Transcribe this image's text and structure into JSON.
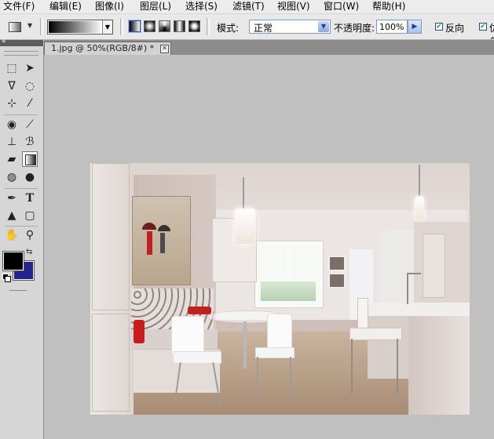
{
  "menu": [
    "文件(F)",
    "编辑(E)",
    "图像(I)",
    "图层(L)",
    "选择(S)",
    "滤镜(T)",
    "视图(V)",
    "窗口(W)",
    "帮助(H)"
  ],
  "options": {
    "mode_label": "模式:",
    "mode_value": "正常",
    "opacity_label": "不透明度:",
    "opacity_value": "100%",
    "reverse_label": "反向",
    "dither_label": "仿色"
  },
  "document": {
    "tab_title": "1.jpg @ 50%(RGB/8#) *",
    "close_symbol": "✕"
  },
  "colors": {
    "foreground": "#000000",
    "background": "#22248c"
  },
  "tools": {
    "text_tool": "T"
  }
}
